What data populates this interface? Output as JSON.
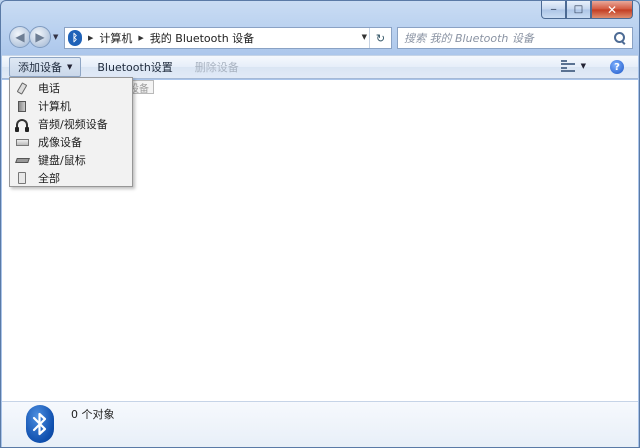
{
  "window": {
    "caption": {
      "min": "‒",
      "max": "□",
      "close": "✕"
    }
  },
  "address": {
    "crumbs": [
      "计算机",
      "我的 Bluetooth 设备"
    ],
    "refresh_icon": "refresh-icon"
  },
  "search": {
    "placeholder": "搜索 我的 Bluetooth 设备"
  },
  "toolbar": {
    "add_device": "添加设备",
    "bluetooth_settings": "Bluetooth设置",
    "remove_device": "删除设备"
  },
  "ghost_tooltip": "设备",
  "menu": {
    "items": [
      {
        "label": "电话",
        "icon": "phone-icon"
      },
      {
        "label": "计算机",
        "icon": "computer-icon"
      },
      {
        "label": "音频/视频设备",
        "icon": "headset-icon"
      },
      {
        "label": "成像设备",
        "icon": "scanner-icon"
      },
      {
        "label": "键盘/鼠标",
        "icon": "keyboard-icon"
      },
      {
        "label": "全部",
        "icon": "all-devices-icon"
      }
    ]
  },
  "details": {
    "count": "0 个对象"
  },
  "colors": {
    "accent": "#1f62b8",
    "window_frame": "#b4cdee",
    "close_red": "#c23b20"
  }
}
